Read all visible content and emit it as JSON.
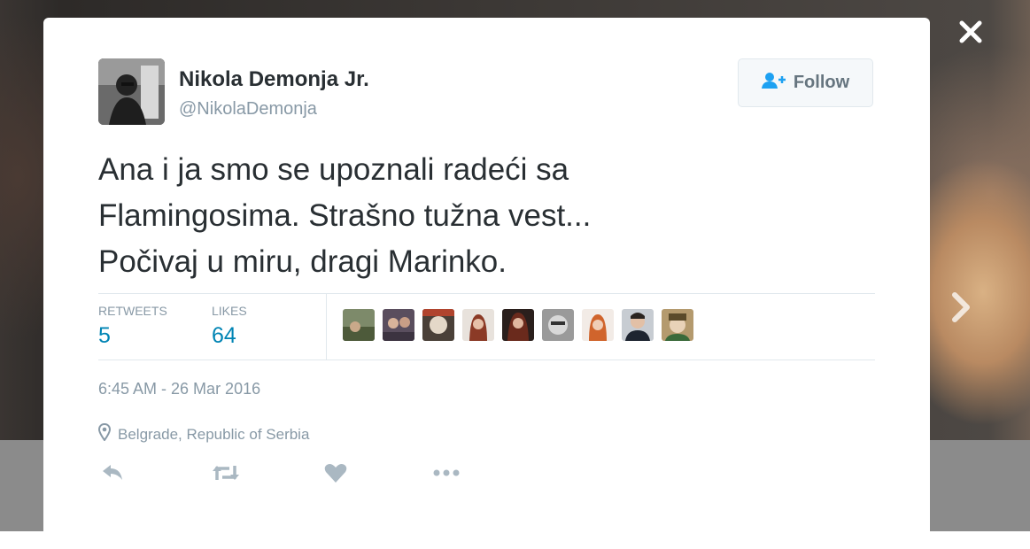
{
  "user": {
    "display_name": "Nikola Demonja Jr.",
    "handle": "@NikolaDemonja"
  },
  "follow_button": {
    "label": "Follow",
    "icon": "add-user-icon"
  },
  "tweet": {
    "text_lines": [
      "Ana i ja smo se upoznali radeći sa",
      "Flamingosima. Strašno tužna vest...",
      "Počivaj u miru, dragi Marinko."
    ]
  },
  "stats": {
    "retweets": {
      "label": "RETWEETS",
      "value": "5"
    },
    "likes": {
      "label": "LIKES",
      "value": "64"
    }
  },
  "liker_avatars_count": 9,
  "timestamp": "6:45 AM - 26 Mar 2016",
  "location": {
    "icon": "location-pin-icon",
    "text": "Belgrade, Republic of Serbia"
  },
  "actions": [
    "reply-icon",
    "retweet-icon",
    "like-heart-icon",
    "more-icon"
  ],
  "overlay": {
    "close_icon": "close-icon",
    "next_icon": "chevron-right-icon"
  },
  "colors": {
    "link_blue": "#0084b4",
    "muted_gray": "#8899a6",
    "text_dark": "#292f33"
  }
}
